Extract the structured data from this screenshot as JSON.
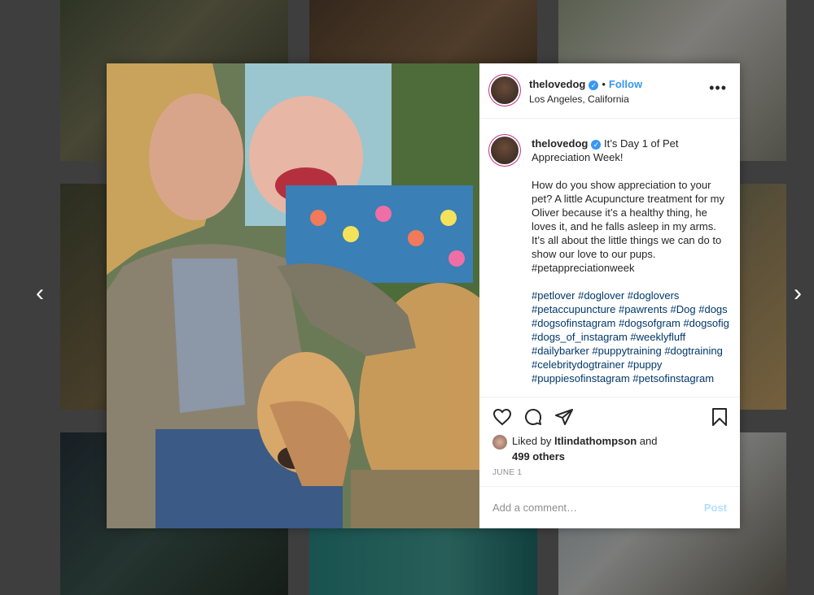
{
  "post": {
    "username": "thelovedog",
    "follow_label": "Follow",
    "location": "Los Angeles, California",
    "more_label": "•••",
    "caption": {
      "line1": "It’s Day 1 of Pet Appreciation Week!",
      "body": "How do you show appreciation to your pet? A little Acupuncture treatment for my Oliver because it’s a healthy thing, he loves it, and he falls asleep in my arms. It’s all about the little things we can do to show our love to our pups. #petappreciationweek",
      "hashtags": "#petlover #doglover #doglovers #petaccupuncture #pawrents #Dog #dogs #dogsofinstagram #dogsofgram #dogsofig #dogs_of_instagram #weeklyfluff #dailybarker #puppytraining #dogtraining #celebritydogtrainer #puppy #puppiesofinstagram #petsofinstagram"
    },
    "likes": {
      "liked_by": "Liked by",
      "liker": "ltlindathompson",
      "and": "and",
      "others": "499 others"
    },
    "date": "JUNE 1",
    "comment_placeholder": "Add a comment…",
    "post_label": "Post"
  },
  "nav": {
    "prev": "‹",
    "next": "›"
  },
  "icons": {
    "like": "heart-icon",
    "comment": "comment-icon",
    "share": "share-icon",
    "save": "bookmark-icon",
    "verified": "verified-badge-icon"
  },
  "colors": {
    "link": "#3897f0",
    "hashtag": "#00376b",
    "muted": "#8e8e8e"
  }
}
